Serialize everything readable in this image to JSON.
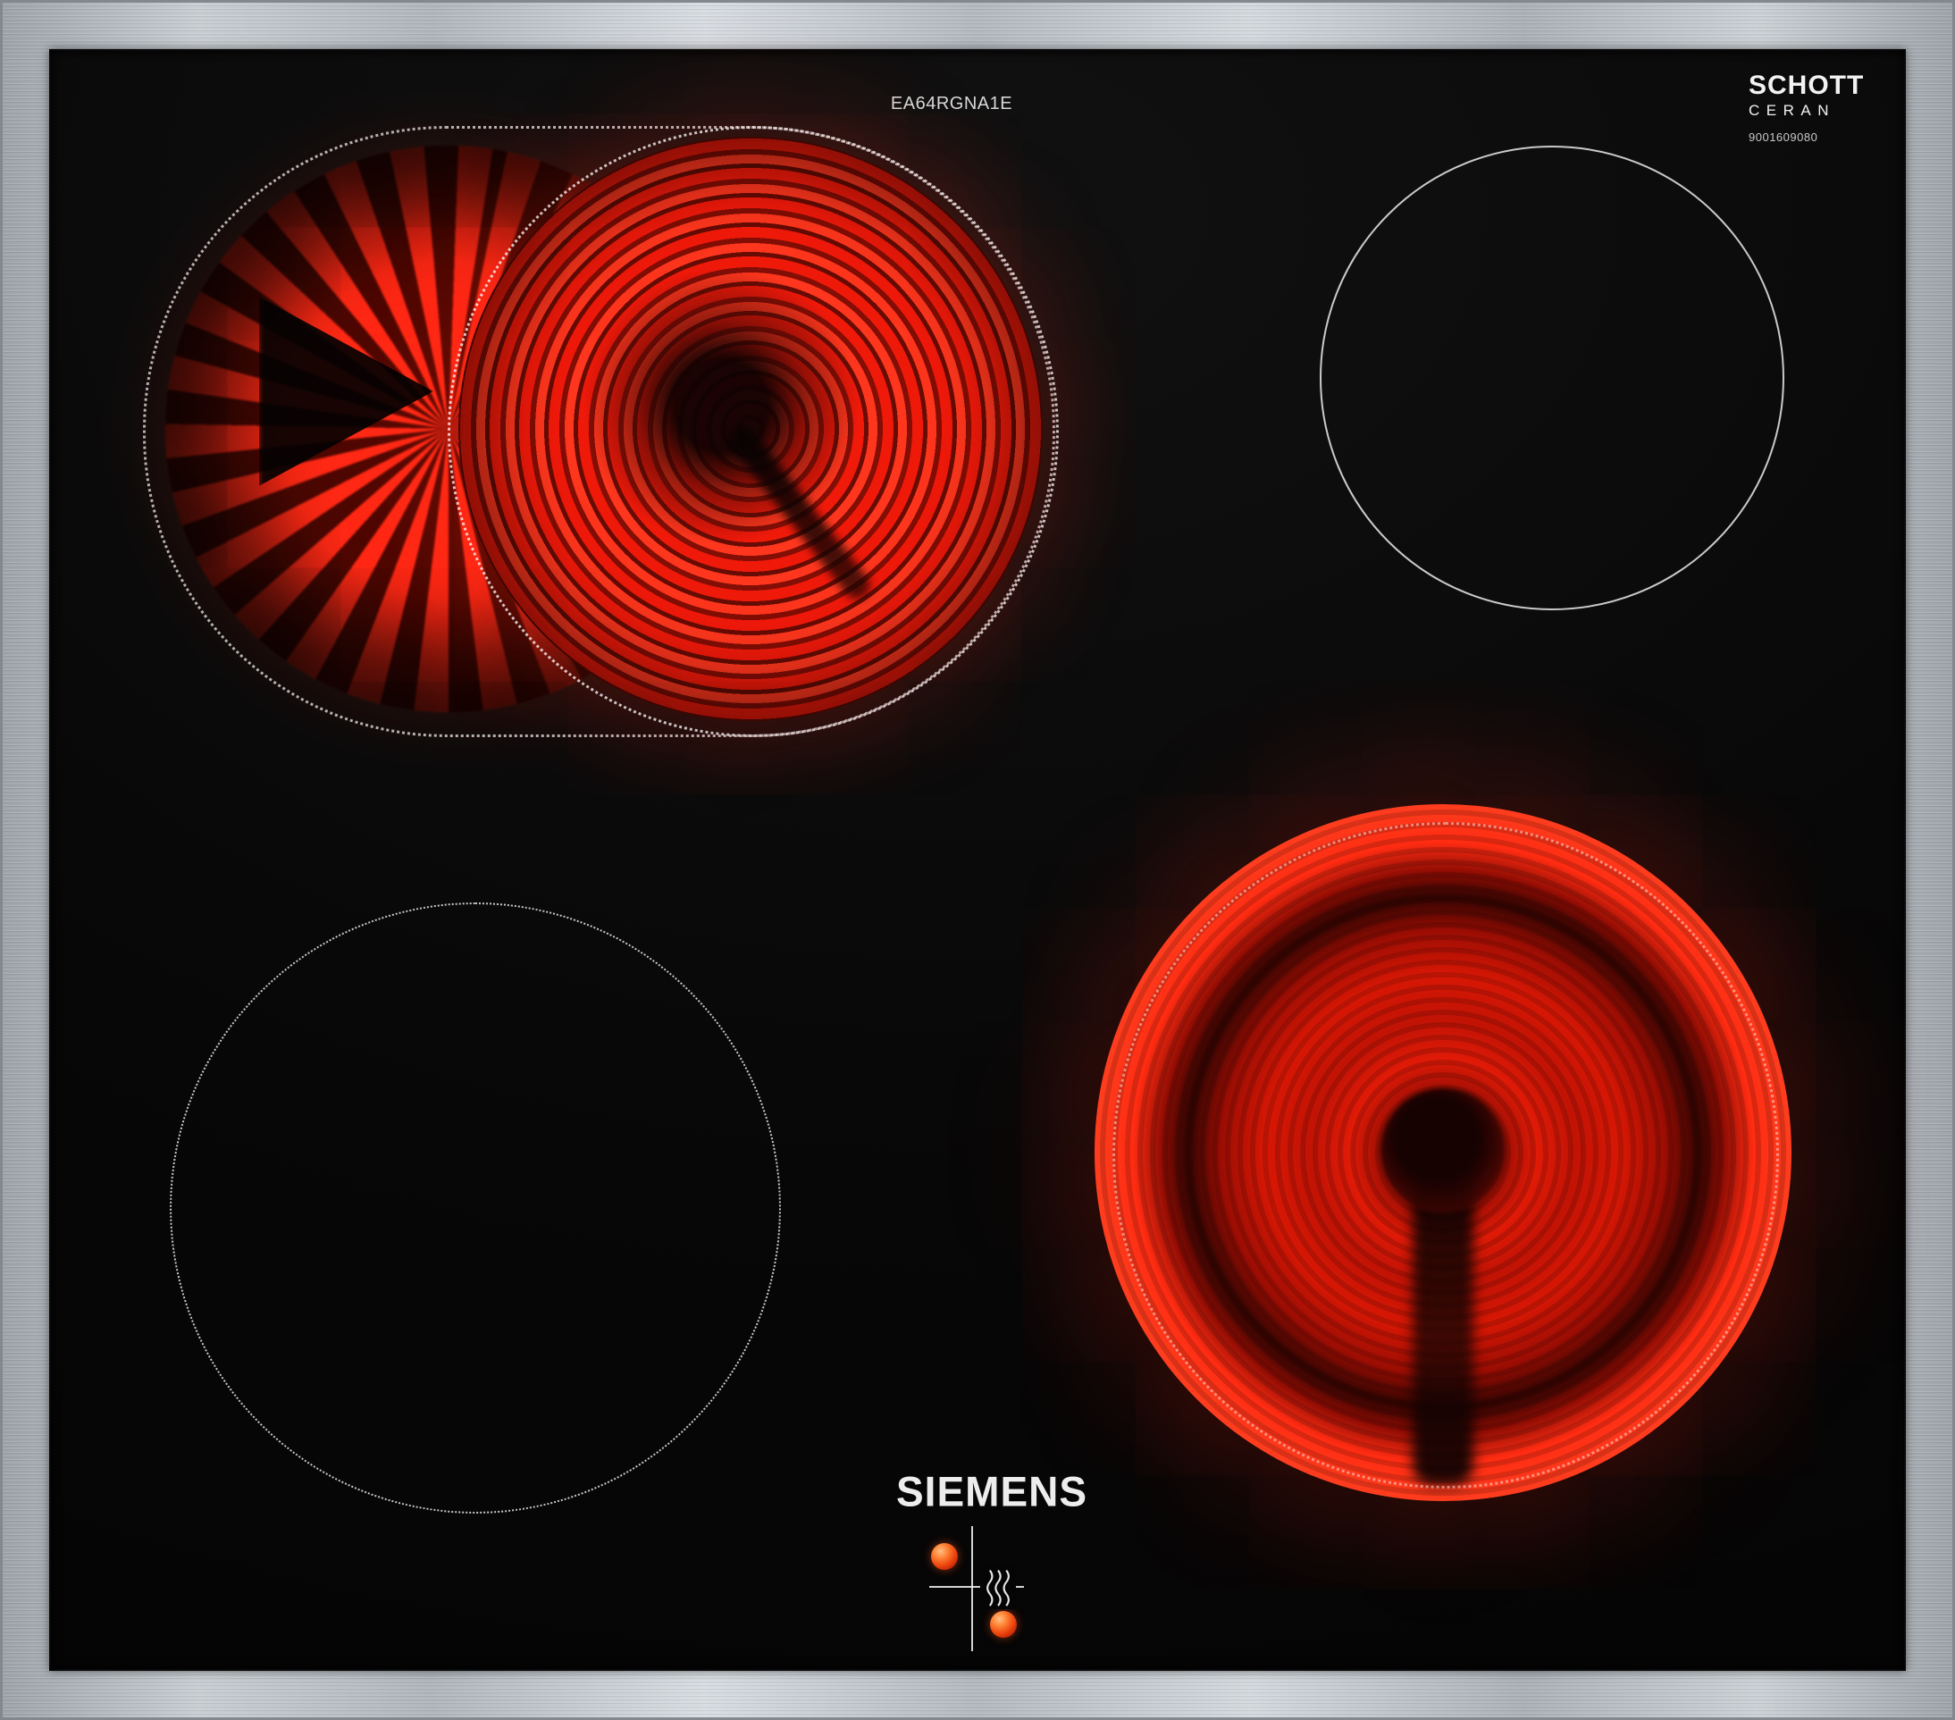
{
  "branding": {
    "manufacturer_logo": "SIEMENS",
    "model_number": "EA64RGNA1E",
    "glass_logo_line1": "SCHOTT",
    "glass_logo_line2": "CERAN",
    "glass_serial": "9001609080"
  },
  "zones": [
    {
      "id": "rear-left",
      "label": "rear left dual extendable cooking zone",
      "state": "on",
      "glow": "bright red halogen coil with oval extension"
    },
    {
      "id": "rear-right",
      "label": "rear right cooking zone",
      "state": "off",
      "glow": "none"
    },
    {
      "id": "front-left",
      "label": "front left cooking zone",
      "state": "off",
      "glow": "none"
    },
    {
      "id": "front-right",
      "label": "front right cooking zone",
      "state": "on",
      "glow": "bright red radiant ring with dark hub"
    }
  ],
  "markings": {
    "residual_heat_icon": "heat-waves-icon",
    "hot_dot_top": "red indicator dot",
    "hot_dot_bottom": "red indicator dot"
  },
  "colors": {
    "glow_red": "#ff2a12",
    "deep_red": "#8e0b02",
    "glass_black": "#070707",
    "steel": "#c3c8cd",
    "outline_white": "#ececec"
  }
}
